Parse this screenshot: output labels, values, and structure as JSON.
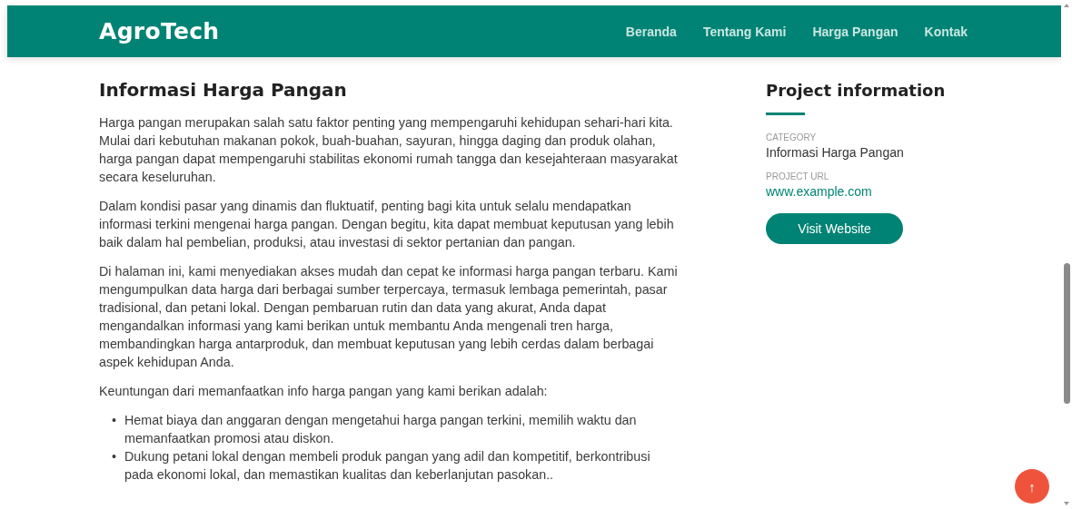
{
  "header": {
    "logo": "AgroTech",
    "nav": [
      {
        "label": "Beranda"
      },
      {
        "label": "Tentang Kami"
      },
      {
        "label": "Harga Pangan"
      },
      {
        "label": "Kontak"
      }
    ]
  },
  "article": {
    "title": "Informasi Harga Pangan",
    "paragraphs": [
      "Harga pangan merupakan salah satu faktor penting yang mempengaruhi kehidupan sehari-hari kita. Mulai dari kebutuhan makanan pokok, buah-buahan, sayuran, hingga daging dan produk olahan, harga pangan dapat mempengaruhi stabilitas ekonomi rumah tangga dan kesejahteraan masyarakat secara keseluruhan.",
      "Dalam kondisi pasar yang dinamis dan fluktuatif, penting bagi kita untuk selalu mendapatkan informasi terkini mengenai harga pangan. Dengan begitu, kita dapat membuat keputusan yang lebih baik dalam hal pembelian, produksi, atau investasi di sektor pertanian dan pangan.",
      "Di halaman ini, kami menyediakan akses mudah dan cepat ke informasi harga pangan terbaru. Kami mengumpulkan data harga dari berbagai sumber terpercaya, termasuk lembaga pemerintah, pasar tradisional, dan petani lokal. Dengan pembaruan rutin dan data yang akurat, Anda dapat mengandalkan informasi yang kami berikan untuk membantu Anda mengenali tren harga, membandingkan harga antarproduk, dan membuat keputusan yang lebih cerdas dalam berbagai aspek kehidupan Anda.",
      "Keuntungan dari memanfaatkan info harga pangan yang kami berikan adalah:"
    ],
    "bullet_marker": "•",
    "bullets": [
      "Hemat biaya dan anggaran dengan mengetahui harga pangan terkini, memilih waktu dan memanfaatkan promosi atau diskon.",
      "Dukung petani lokal dengan membeli produk pangan yang adil dan kompetitif, berkontribusi pada ekonomi lokal, dan memastikan kualitas dan keberlanjutan pasokan.."
    ]
  },
  "sidebar": {
    "title": "Project information",
    "fields": [
      {
        "label": "CATEGORY",
        "value": "Informasi Harga Pangan",
        "kind": "text"
      },
      {
        "label": "PROJECT URL",
        "value": "www.example.com",
        "kind": "link"
      }
    ],
    "button": "Visit Website"
  },
  "back_to_top": "↑"
}
